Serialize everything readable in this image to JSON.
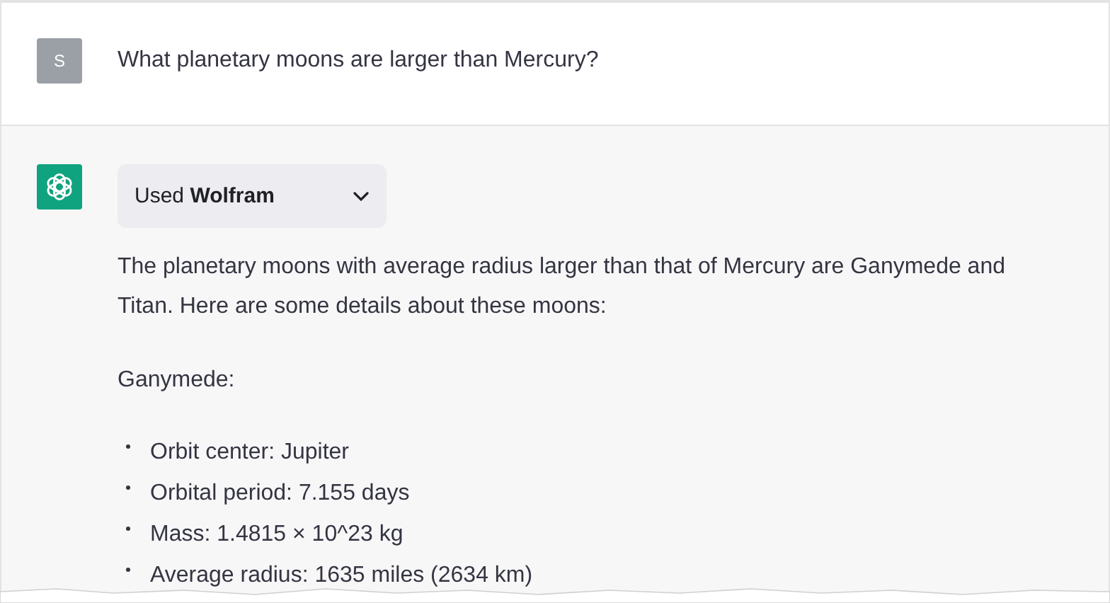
{
  "user_message": {
    "avatar_letter": "S",
    "text": "What planetary moons are larger than Mercury?"
  },
  "assistant_message": {
    "tool_dropdown": {
      "prefix": "Used",
      "tool": "Wolfram",
      "expanded": false
    },
    "paragraph": "The planetary moons with average radius larger than that of Mercury are Ganymede and Titan. Here are some details about these moons:",
    "heading": "Ganymede:",
    "bullets": [
      "Orbit center: Jupiter",
      "Orbital period: 7.155 days",
      "Mass: 1.4815 × 10^23 kg",
      "Average radius: 1635 miles (2634 km)"
    ]
  }
}
